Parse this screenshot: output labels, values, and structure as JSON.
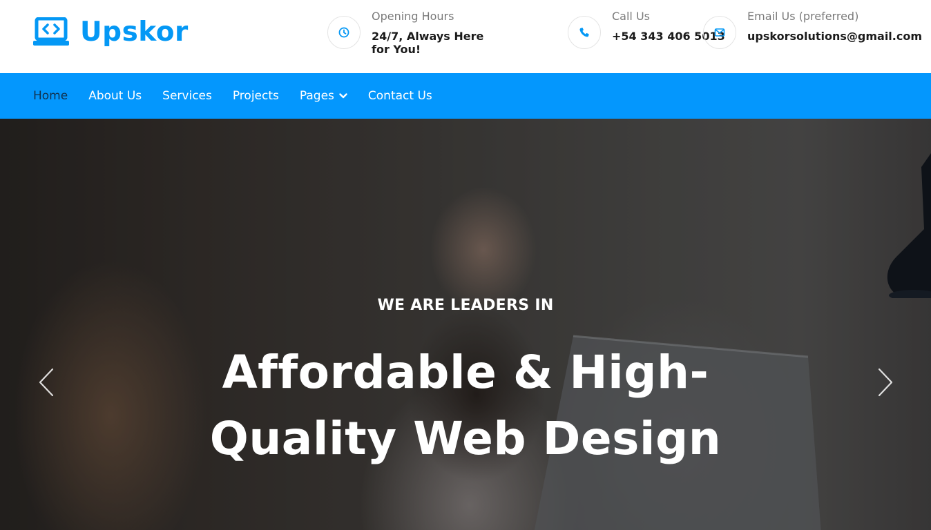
{
  "brand": {
    "name": "Upskor",
    "color": "#0498f5"
  },
  "contact": {
    "hours": {
      "icon": "clock-icon",
      "label": "Opening Hours",
      "value": "24/7, Always Here for You!"
    },
    "call": {
      "icon": "phone-icon",
      "label": "Call Us",
      "value": "+54 343 406 5013"
    },
    "email": {
      "icon": "envelope-icon",
      "label": "Email Us (preferred)",
      "value": "upskorsolutions@gmail.com"
    }
  },
  "nav": {
    "background": "#0497fd",
    "items": [
      {
        "label": "Home",
        "active": true
      },
      {
        "label": "About Us"
      },
      {
        "label": "Services"
      },
      {
        "label": "Projects"
      },
      {
        "label": "Pages",
        "has_dropdown": true
      },
      {
        "label": "Contact Us"
      }
    ]
  },
  "hero": {
    "kicker": "WE ARE LEADERS IN",
    "title": "Affordable & High-Quality Web Design",
    "prev_icon": "chevron-left-icon",
    "next_icon": "chevron-right-icon"
  }
}
